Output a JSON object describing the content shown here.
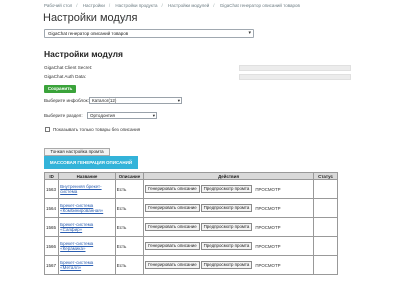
{
  "breadcrumb": [
    "Рабочий стол",
    "Настройки",
    "Настройки продукта",
    "Настройки модулей",
    "GigaChat генератор описаний товаров"
  ],
  "page": {
    "title": "Настройки модуля",
    "star_icon": "star-icon"
  },
  "module_select": {
    "selected": "GigaChat генератор описаний товаров"
  },
  "settings": {
    "title": "Настройки модуля",
    "client_secret_label": "GigaChat Client Secret:",
    "auth_data_label": "GigaChat Auth Data:",
    "save_label": "Сохранить",
    "iblock_label": "Выберите инфоблок:",
    "iblock_selected": "Каталог(12)",
    "section_label": "Выберите раздел:",
    "section_selected": "Ортодонтия",
    "only_no_desc_label": "Показывать только товары без описания"
  },
  "tabs": {
    "prompt_settings": "Тонкая настройка промта"
  },
  "mass_button": "МАССОВАЯ ГЕНЕРАЦИЯ ОПИСАНИЙ",
  "table": {
    "headers": [
      "ID",
      "Название",
      "Описание",
      "Действия",
      "Статус"
    ],
    "rows": [
      {
        "id": "1563",
        "name": "Внутренняя брекет-система",
        "desc": "Есть"
      },
      {
        "id": "1564",
        "name": "Брекет-система «Комбинированная»",
        "desc": "Есть"
      },
      {
        "id": "1565",
        "name": "Брекет-система «Сапфир»",
        "desc": "Есть"
      },
      {
        "id": "1566",
        "name": "Брекет-система «Керамика»",
        "desc": "Есть"
      },
      {
        "id": "1567",
        "name": "Брекет-система «Металл»",
        "desc": "Есть"
      }
    ],
    "generate_label": "Генерировать описание",
    "preview_label": "Предпросмотр промта",
    "view_label": "ПРОСМОТР"
  }
}
